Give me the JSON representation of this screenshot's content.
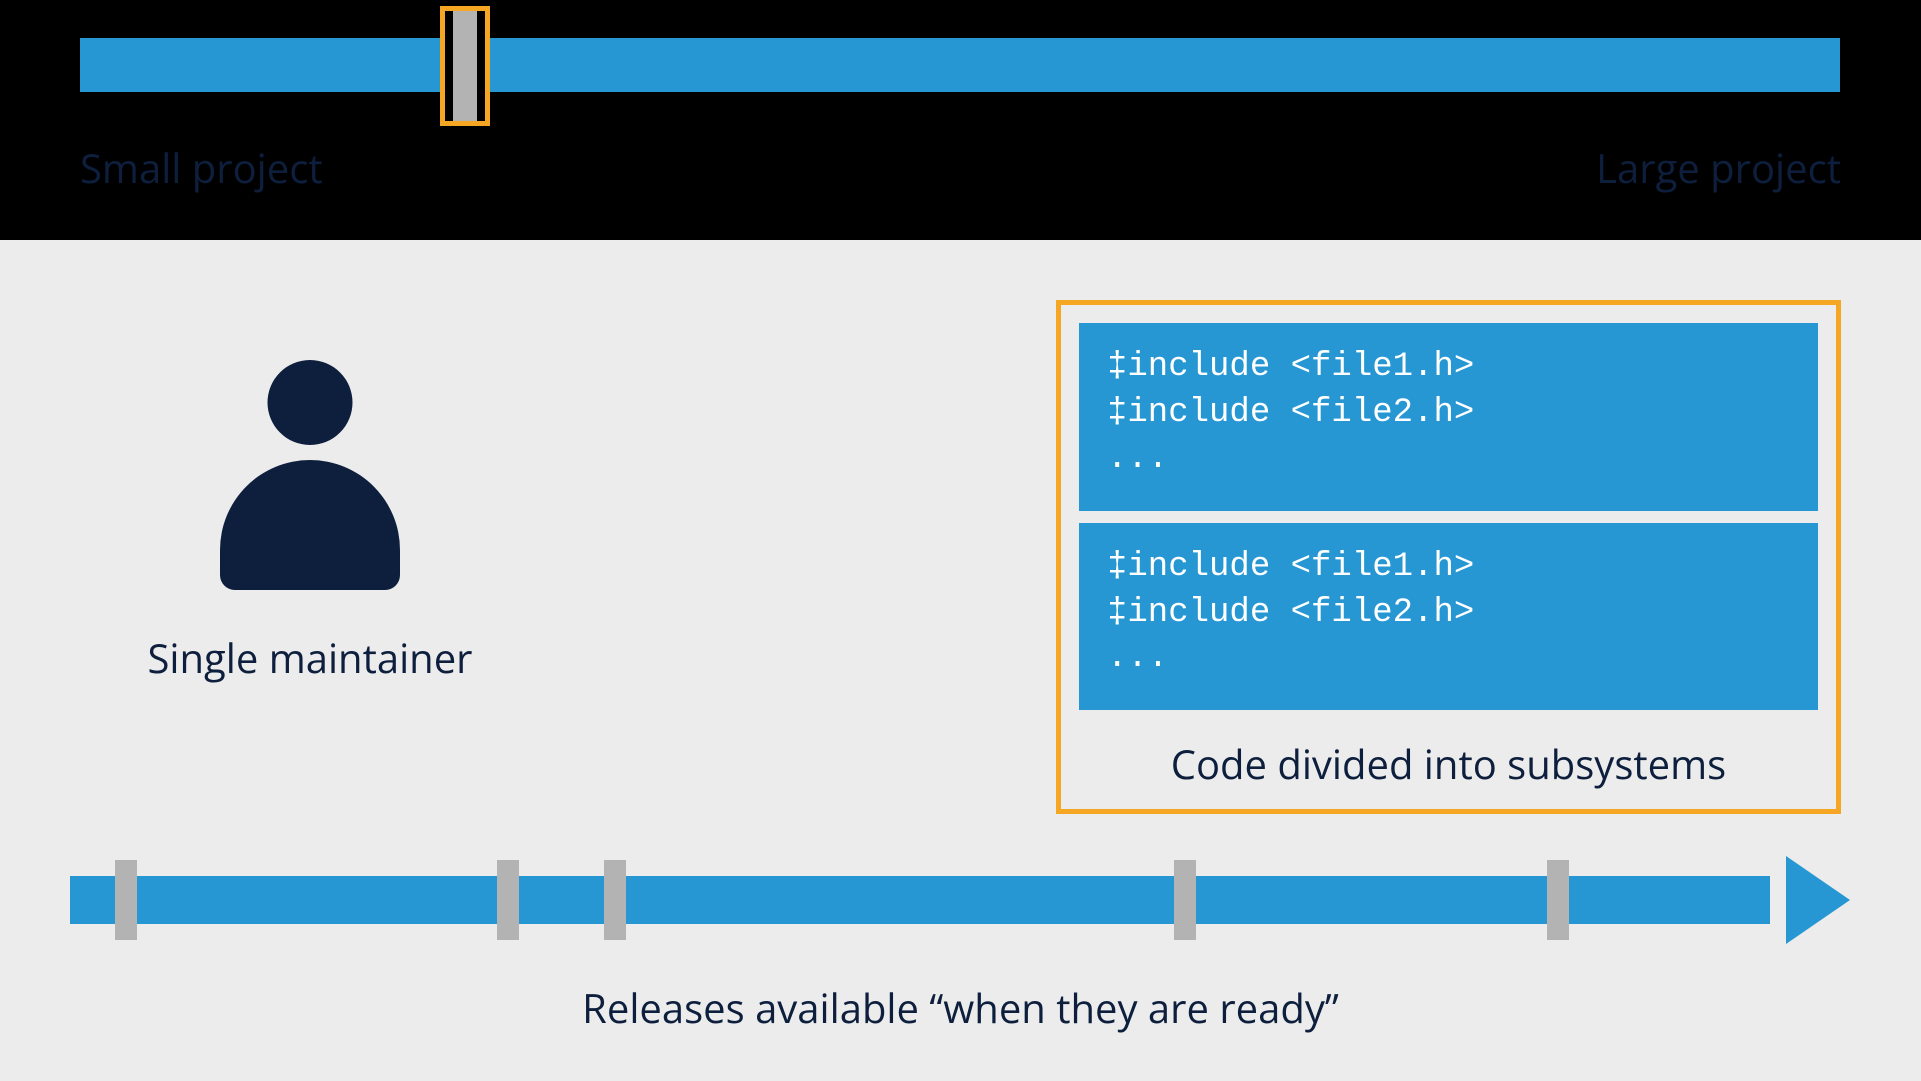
{
  "colors": {
    "blue": "#2697d3",
    "navy": "#0d1f3d",
    "orange": "#f5a623",
    "grey": "#b3b3b3",
    "lightbg": "#ececec"
  },
  "spectrum": {
    "left_label": "Small project",
    "right_label": "Large project",
    "handle_position_pct": 22
  },
  "person": {
    "label": "Single maintainer"
  },
  "code_box": {
    "panels": [
      "‡include <file1.h>\n‡include <file2.h>\n...",
      "‡include <file1.h>\n‡include <file2.h>\n..."
    ],
    "label": "Code divided into subsystems"
  },
  "timeline": {
    "label": "Releases available “when they are ready”",
    "tick_positions_pct": [
      2.5,
      24,
      30,
      62,
      83
    ]
  }
}
